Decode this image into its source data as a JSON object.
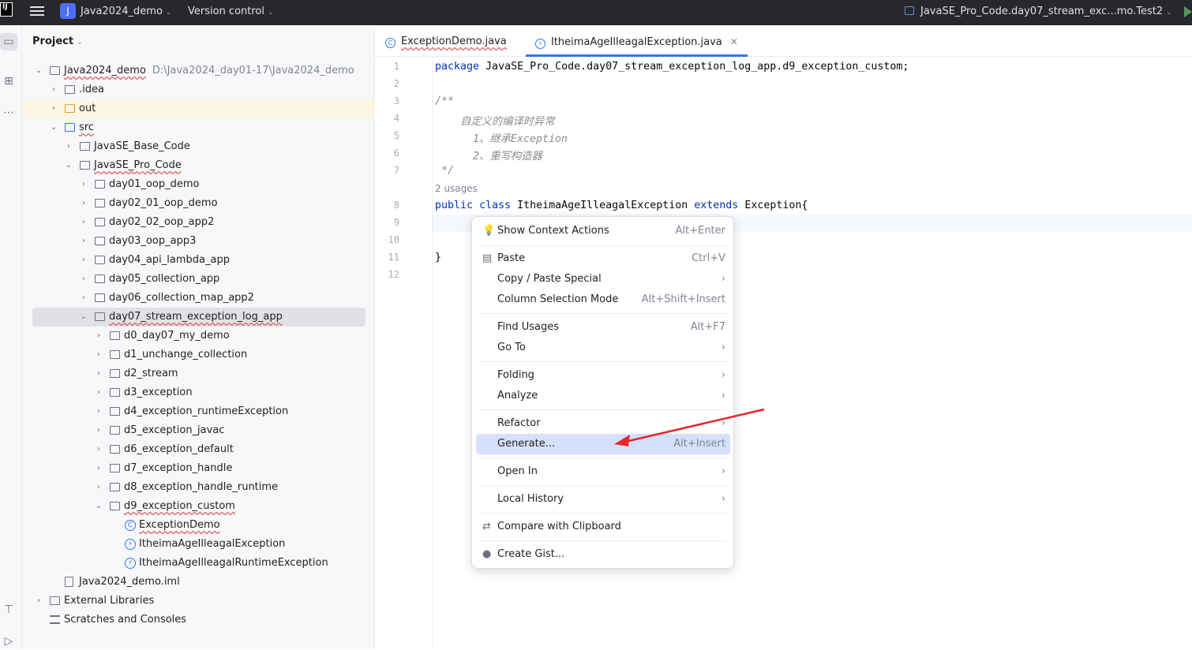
{
  "topbar": {
    "project_badge": "J",
    "project_name": "Java2024_demo",
    "version_control": "Version control",
    "run_config": "JavaSE_Pro_Code.day07_stream_exc...mo.Test2"
  },
  "panel": {
    "title": "Project"
  },
  "tree": [
    {
      "label": "Java2024_demo",
      "path": "D:\\Java2024_day01-17\\Java2024_demo"
    },
    {
      "label": ".idea"
    },
    {
      "label": "out"
    },
    {
      "label": "src"
    },
    {
      "label": "JavaSE_Base_Code"
    },
    {
      "label": "JavaSE_Pro_Code"
    },
    {
      "label": "day01_oop_demo"
    },
    {
      "label": "day02_01_oop_demo"
    },
    {
      "label": "day02_02_oop_app2"
    },
    {
      "label": "day03_oop_app3"
    },
    {
      "label": "day04_api_lambda_app"
    },
    {
      "label": "day05_collection_app"
    },
    {
      "label": "day06_collection_map_app2"
    },
    {
      "label": "day07_stream_exception_log_app"
    },
    {
      "label": "d0_day07_my_demo"
    },
    {
      "label": "d1_unchange_collection"
    },
    {
      "label": "d2_stream"
    },
    {
      "label": "d3_exception"
    },
    {
      "label": "d4_exception_runtimeException"
    },
    {
      "label": "d5_exception_javac"
    },
    {
      "label": "d6_exception_default"
    },
    {
      "label": "d7_exception_handle"
    },
    {
      "label": "d8_exception_handle_runtime"
    },
    {
      "label": "d9_exception_custom"
    },
    {
      "label": "ExceptionDemo"
    },
    {
      "label": "ItheimaAgeIlleagalException"
    },
    {
      "label": "ItheimaAgeIlleagalRuntimeException"
    },
    {
      "label": "Java2024_demo.iml"
    },
    {
      "label": "External Libraries"
    },
    {
      "label": "Scratches and Consoles"
    }
  ],
  "tabs": [
    {
      "label": "ExceptionDemo.java"
    },
    {
      "label": "ItheimaAgeIlleagalException.java"
    }
  ],
  "code": {
    "line_numbers": [
      "1",
      "2",
      "3",
      "4",
      "5",
      "6",
      "7",
      "8",
      "9",
      "10",
      "11",
      "12"
    ],
    "package_kw": "package",
    "package_name": " JavaSE_Pro_Code.day07_stream_exception_log_app.d9_exception_custom;",
    "doc_open": "/**",
    "doc_line1": "    自定义的编译时异常",
    "doc_line2": "      1、继承Exception",
    "doc_line3": "      2、重写构造器",
    "doc_close": " */",
    "usages_hint": "2 usages",
    "decl_public": "public",
    "decl_class": "class",
    "decl_name": " ItheimaAgeIlleagalException ",
    "decl_extends": "extends",
    "decl_super": " Exception{",
    "close_brace": "}"
  },
  "context_menu": [
    {
      "label": "Show Context Actions",
      "shortcut": "Alt+Enter",
      "icon": "lightbulb-icon"
    },
    {
      "label": "Paste",
      "shortcut": "Ctrl+V",
      "icon": "clipboard-icon"
    },
    {
      "label": "Copy / Paste Special",
      "shortcut": "›"
    },
    {
      "label": "Column Selection Mode",
      "shortcut": "Alt+Shift+Insert"
    },
    {
      "label": "Find Usages",
      "shortcut": "Alt+F7"
    },
    {
      "label": "Go To",
      "shortcut": "›"
    },
    {
      "label": "Folding",
      "shortcut": "›"
    },
    {
      "label": "Analyze",
      "shortcut": "›"
    },
    {
      "label": "Refactor",
      "shortcut": "›"
    },
    {
      "label": "Generate...",
      "shortcut": "Alt+Insert"
    },
    {
      "label": "Open In",
      "shortcut": "›"
    },
    {
      "label": "Local History",
      "shortcut": "›"
    },
    {
      "label": "Compare with Clipboard",
      "shortcut": ""
    },
    {
      "label": "Create Gist...",
      "shortcut": "",
      "icon": "github-icon"
    }
  ],
  "colors": {
    "accent": "#3574f0",
    "keyword": "#0033b3",
    "comment": "#8c8c8c",
    "arrow": "#e5262e"
  }
}
